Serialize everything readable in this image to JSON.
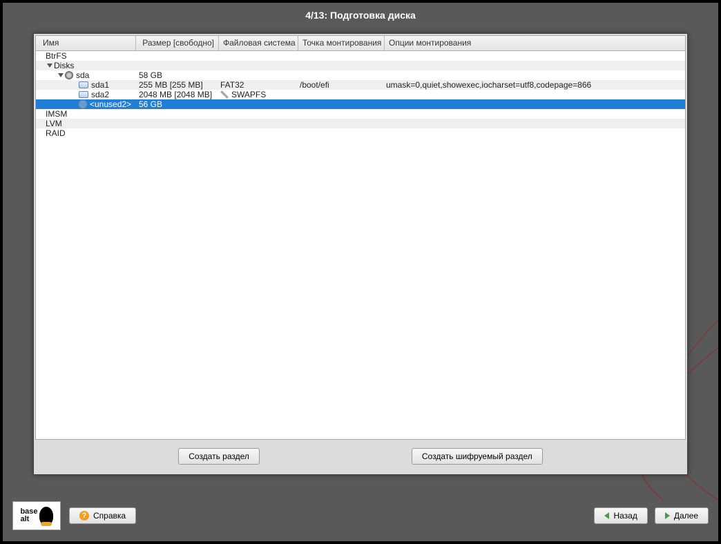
{
  "title": "4/13: Подготовка диска",
  "columns": {
    "name": "Имя",
    "size": "Размер [свободно]",
    "fs": "Файловая система",
    "mount": "Точка монтирования",
    "opts": "Опции монтирования"
  },
  "rows": [
    {
      "name": "BtrFS",
      "indent": 1,
      "stripe": false
    },
    {
      "name": "Disks",
      "indent": 1,
      "stripe": true,
      "expanded": true
    },
    {
      "name": "sda",
      "indent": 2,
      "icon": "disk",
      "expanded": true,
      "size": "58 GB",
      "stripe": false
    },
    {
      "name": "sda1",
      "indent": 3,
      "icon": "part",
      "size": "255 MB [255 MB]",
      "fs": "FAT32",
      "mount": "/boot/efi",
      "opts": "umask=0,quiet,showexec,iocharset=utf8,codepage=866",
      "stripe": true
    },
    {
      "name": "sda2",
      "indent": 3,
      "icon": "part",
      "size": "2048 MB [2048 MB]",
      "fsicon": "wrench",
      "fs": "SWAPFS",
      "stripe": false
    },
    {
      "name": "<unused2>",
      "indent": 3,
      "icon": "unused",
      "size": "56 GB",
      "selected": true
    },
    {
      "name": "IMSM",
      "indent": 1,
      "stripe": false
    },
    {
      "name": "LVM",
      "indent": 1,
      "stripe": true
    },
    {
      "name": "RAID",
      "indent": 1,
      "stripe": false
    }
  ],
  "buttons": {
    "create_partition": "Создать раздел",
    "create_encrypted": "Создать шифруемый раздел"
  },
  "nav": {
    "help": "Справка",
    "back": "Назад",
    "next": "Далее"
  },
  "logo": {
    "line1": "base",
    "line2": "alt"
  }
}
